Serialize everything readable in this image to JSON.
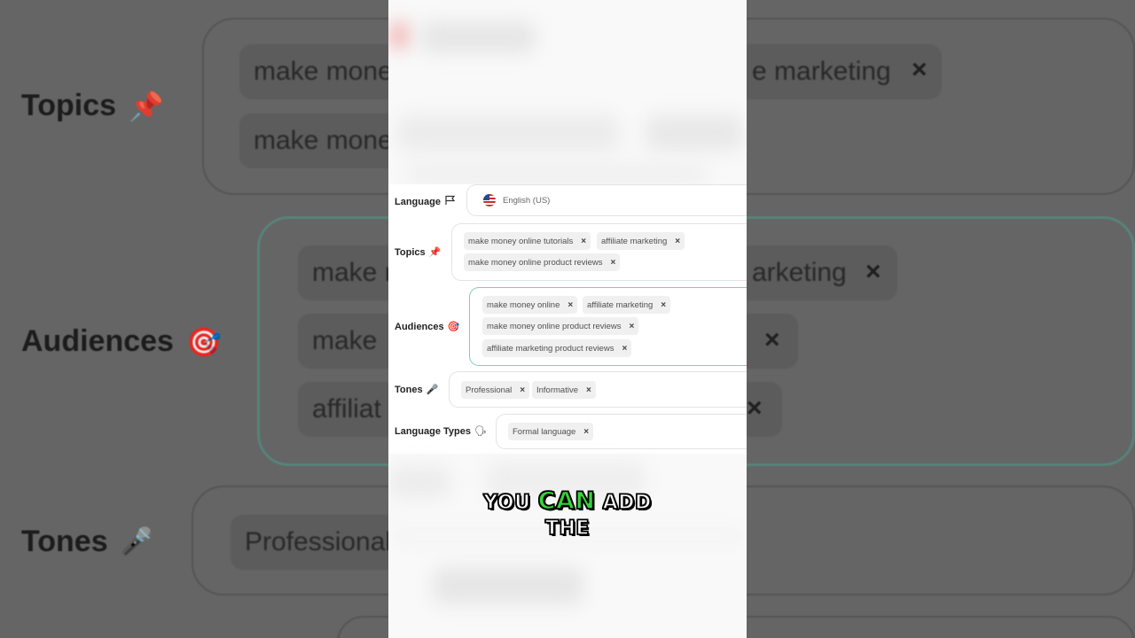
{
  "form": {
    "language": {
      "label": "Language",
      "icon": "flag-outline-icon",
      "value": "English (US)",
      "flag": "us-flag-icon"
    },
    "topics": {
      "label": "Topics",
      "icon": "pushpin-icon",
      "chips": [
        "make money online tutorials",
        "affiliate marketing",
        "make money online product reviews"
      ]
    },
    "audiences": {
      "label": "Audiences",
      "icon": "target-icon",
      "chips": [
        "make money online",
        "affiliate marketing",
        "make money online product reviews",
        "affiliate marketing product reviews"
      ]
    },
    "tones": {
      "label": "Tones",
      "icon": "microphone-icon",
      "chips": [
        "Professional",
        "Informative"
      ]
    },
    "language_types": {
      "label": "Language Types",
      "icon": "speaking-head-icon",
      "chips": [
        "Formal language"
      ]
    }
  },
  "chip_remove": "×",
  "caption": {
    "line1_a": "YOU",
    "line1_hl": "CAN",
    "line1_b": "ADD",
    "line2": "THE"
  },
  "background": {
    "topics_label": "Topics",
    "audiences_label": "Audiences",
    "tones_label": "Tones",
    "chip_make_money": "make mone",
    "chip_marketing": "e marketing",
    "chip_make_short": "make m",
    "chip_arketing": "arketing",
    "chip_make_money_2": "make mone",
    "chip_make": "make",
    "chip_affiliate": "affiliat",
    "chip_professional": "Professional",
    "close": "×"
  },
  "colors": {
    "focus_border": "#7fcdbb",
    "caption_highlight": "#35d43a"
  }
}
